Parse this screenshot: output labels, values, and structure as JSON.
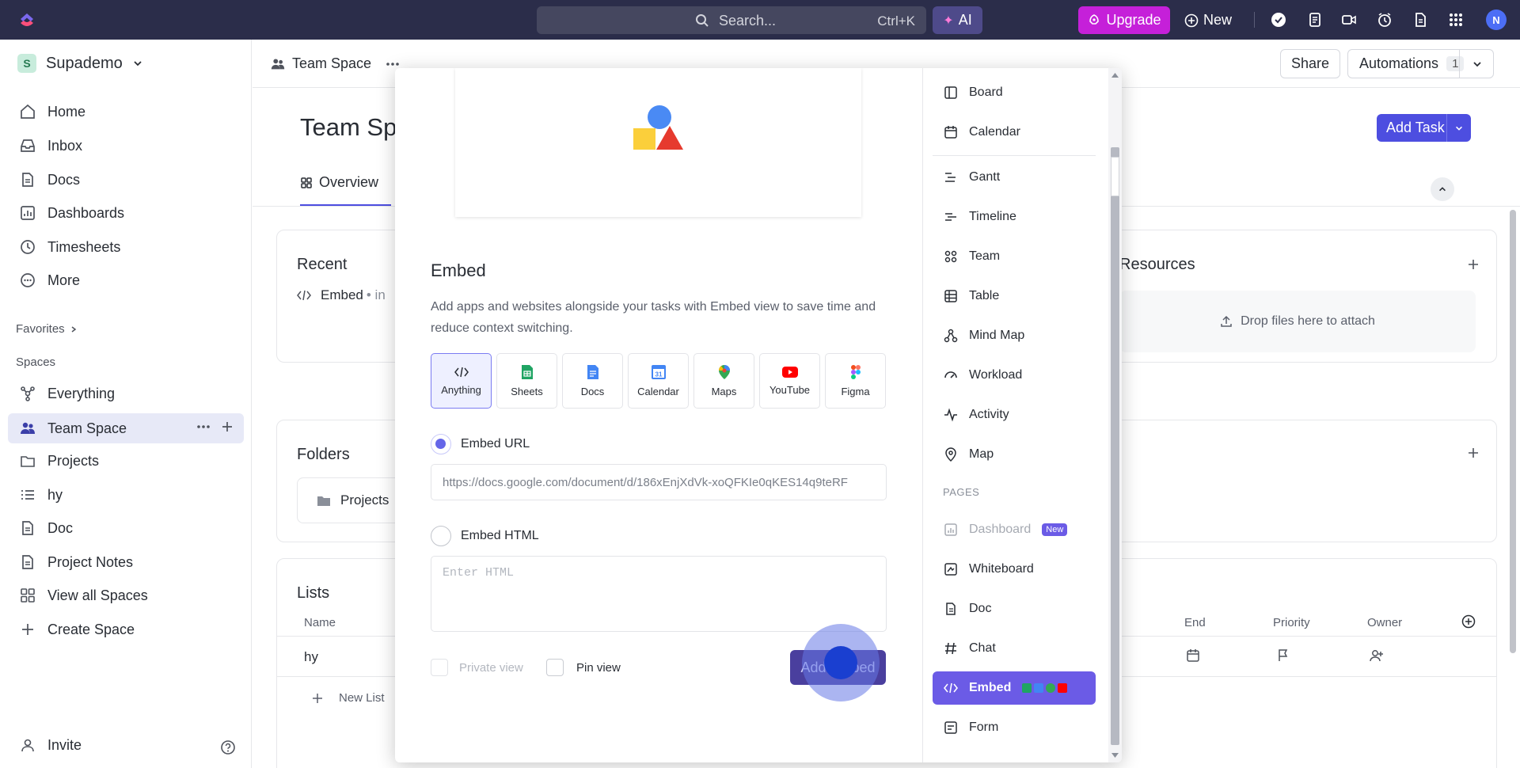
{
  "topbar": {
    "search_placeholder": "Search...",
    "search_shortcut": "Ctrl+K",
    "ai_label": "AI",
    "upgrade_label": "Upgrade",
    "new_label": "New",
    "avatar_initial": "N"
  },
  "sidebar": {
    "workspace_initial": "S",
    "workspace_name": "Supademo",
    "nav": [
      {
        "label": "Home",
        "icon": "home-icon"
      },
      {
        "label": "Inbox",
        "icon": "inbox-icon"
      },
      {
        "label": "Docs",
        "icon": "doc-icon"
      },
      {
        "label": "Dashboards",
        "icon": "dashboard-icon"
      },
      {
        "label": "Timesheets",
        "icon": "clock-icon"
      },
      {
        "label": "More",
        "icon": "more-icon"
      }
    ],
    "favorites_label": "Favorites",
    "spaces_label": "Spaces",
    "spaces": [
      {
        "label": "Everything",
        "icon": "everything-icon"
      },
      {
        "label": "Team Space",
        "icon": "team-icon"
      },
      {
        "label": "Projects",
        "icon": "folder-icon"
      },
      {
        "label": "hy",
        "icon": "list-icon"
      },
      {
        "label": "Doc",
        "icon": "doc-icon"
      },
      {
        "label": "Project Notes",
        "icon": "doc-icon"
      },
      {
        "label": "View all Spaces",
        "icon": "grid-icon"
      },
      {
        "label": "Create Space",
        "icon": "plus-icon"
      }
    ],
    "invite_label": "Invite"
  },
  "main": {
    "breadcrumb": "Team Space",
    "share_label": "Share",
    "automations_label": "Automations",
    "automations_count": "1",
    "page_title": "Team Spa",
    "add_task_label": "Add Task",
    "overview_tab": "Overview",
    "recent_title": "Recent",
    "recent_item": "Embed",
    "recent_item_suffix": "• in",
    "resources_title": "Resources",
    "drop_files": "Drop files here to attach",
    "folders_title": "Folders",
    "folder_item": "Projects",
    "lists_title": "Lists",
    "lists_columns": [
      "Name",
      "End",
      "Priority",
      "Owner"
    ],
    "list_row": "hy",
    "new_list": "New List"
  },
  "modal": {
    "embed_title": "Embed",
    "embed_desc": "Add apps and websites alongside your tasks with Embed view to save time and reduce context switching.",
    "chips": [
      "Anything",
      "Sheets",
      "Docs",
      "Calendar",
      "Maps",
      "YouTube",
      "Figma"
    ],
    "embed_url_label": "Embed URL",
    "embed_url_value": "https://docs.google.com/document/d/186xEnjXdVk-xoQFKIe0qKES14q9teRF",
    "embed_html_label": "Embed HTML",
    "embed_html_placeholder": "Enter HTML",
    "private_view_label": "Private view",
    "pin_view_label": "Pin view",
    "add_embed_label": "Add Embed",
    "views": [
      "Board",
      "Calendar",
      "Gantt",
      "Timeline",
      "Team",
      "Table",
      "Mind Map",
      "Workload",
      "Activity",
      "Map"
    ],
    "pages_label": "PAGES",
    "pages": [
      "Dashboard",
      "Whiteboard",
      "Doc",
      "Chat",
      "Embed",
      "Form"
    ],
    "dashboard_badge": "New"
  },
  "colors": {
    "topbar_bg": "#2b2d4a",
    "accent": "#4d4ee0",
    "upgrade": "#c520d9",
    "selected_view": "#6b5be6"
  }
}
